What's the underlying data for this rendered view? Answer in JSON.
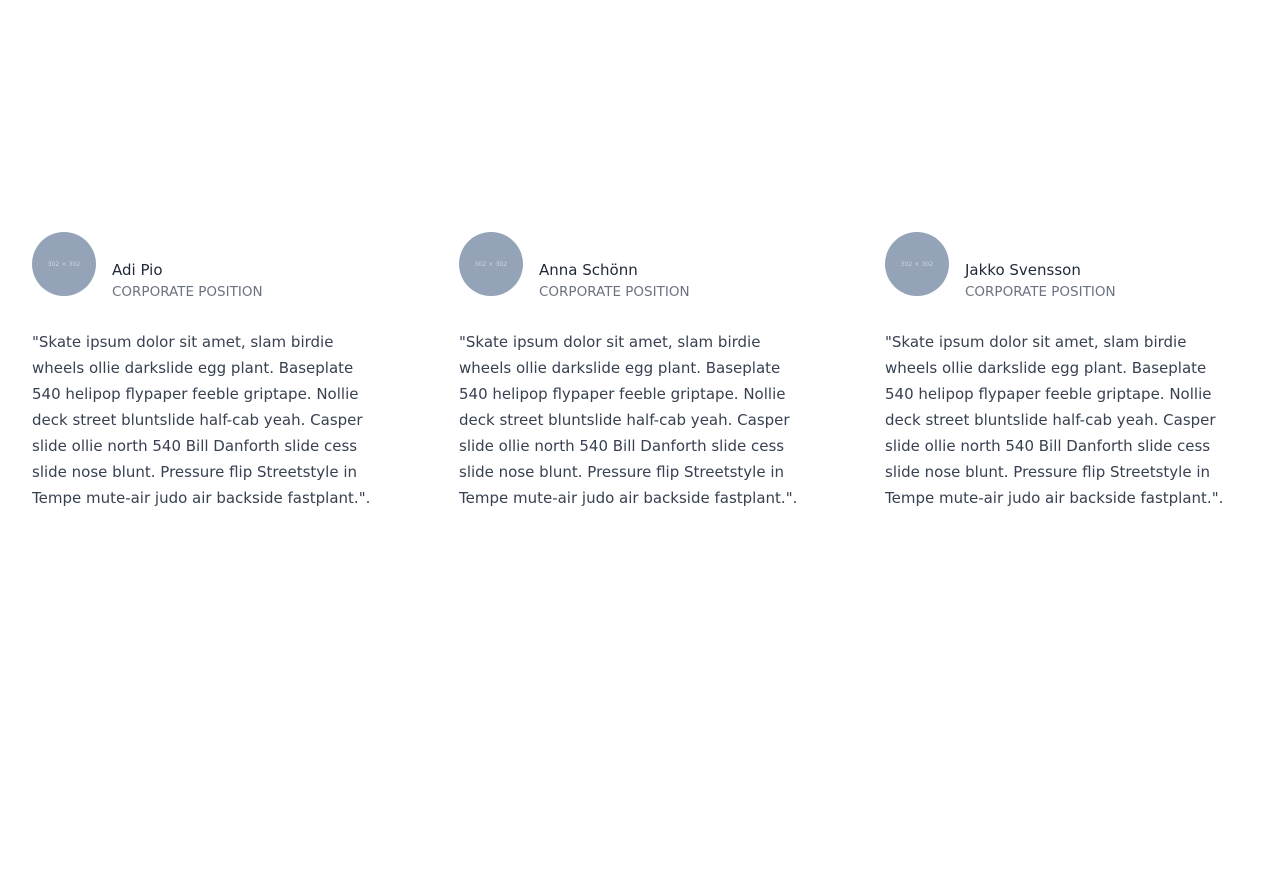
{
  "testimonials": [
    {
      "avatar_text": "302 × 302",
      "name": "Adi Pio",
      "position": "CORPORATE POSITION",
      "quote": "\"Skate ipsum dolor sit amet, slam birdie wheels ollie darkslide egg plant. Baseplate 540 helipop flypaper feeble griptape. Nollie deck street bluntslide half-cab yeah. Casper slide ollie north 540 Bill Danforth slide cess slide nose blunt. Pressure flip Streetstyle in Tempe mute-air judo air backside fastplant.\"."
    },
    {
      "avatar_text": "302 × 302",
      "name": "Anna Schönn",
      "position": "CORPORATE POSITION",
      "quote": "\"Skate ipsum dolor sit amet, slam birdie wheels ollie darkslide egg plant. Baseplate 540 helipop flypaper feeble griptape. Nollie deck street bluntslide half-cab yeah. Casper slide ollie north 540 Bill Danforth slide cess slide nose blunt. Pressure flip Streetstyle in Tempe mute-air judo air backside fastplant.\"."
    },
    {
      "avatar_text": "302 × 302",
      "name": "Jakko Svensson",
      "position": "CORPORATE POSITION",
      "quote": "\"Skate ipsum dolor sit amet, slam birdie wheels ollie darkslide egg plant. Baseplate 540 helipop flypaper feeble griptape. Nollie deck street bluntslide half-cab yeah. Casper slide ollie north 540 Bill Danforth slide cess slide nose blunt. Pressure flip Streetstyle in Tempe mute-air judo air backside fastplant.\"."
    }
  ],
  "colors": {
    "avatar_bg": "#94a3b8",
    "name_text": "#1f2937",
    "position_text": "#6b7280",
    "quote_text": "#374151"
  }
}
